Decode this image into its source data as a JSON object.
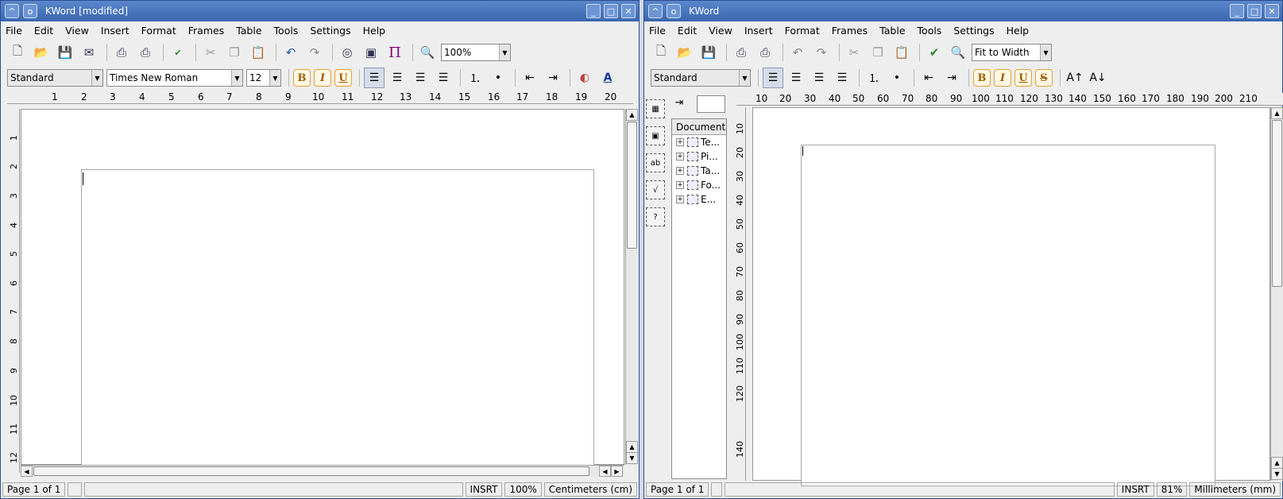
{
  "left": {
    "title": "KWord [modified]",
    "menu": [
      "File",
      "Edit",
      "View",
      "Insert",
      "Format",
      "Frames",
      "Table",
      "Tools",
      "Settings",
      "Help"
    ],
    "zoom": "100%",
    "style": "Standard",
    "font": "Times New Roman",
    "size": "12",
    "bold": "B",
    "italic": "I",
    "underline": "U",
    "ruler_h": [
      "1",
      "2",
      "3",
      "4",
      "5",
      "6",
      "7",
      "8",
      "9",
      "10",
      "11",
      "12",
      "13",
      "14",
      "15",
      "16",
      "17",
      "18",
      "19",
      "20"
    ],
    "ruler_v": [
      "1",
      "2",
      "3",
      "4",
      "5",
      "6",
      "7",
      "8",
      "9",
      "10",
      "11",
      "12"
    ],
    "status": {
      "page": "Page 1 of 1",
      "mode": "INSRT",
      "zoom": "100%",
      "unit": "Centimeters (cm)"
    }
  },
  "right": {
    "title": "KWord",
    "menu": [
      "File",
      "Edit",
      "View",
      "Insert",
      "Format",
      "Frames",
      "Table",
      "Tools",
      "Settings",
      "Help"
    ],
    "zoom": "Fit to Width",
    "style": "Standard",
    "bold": "B",
    "italic": "I",
    "underline": "U",
    "strike": "S",
    "ruler_h": [
      "10",
      "20",
      "30",
      "40",
      "50",
      "60",
      "70",
      "80",
      "90",
      "100",
      "110",
      "120",
      "130",
      "140",
      "150",
      "160",
      "170",
      "180",
      "190",
      "200",
      "210"
    ],
    "ruler_v": [
      "10",
      "20",
      "30",
      "40",
      "50",
      "60",
      "70",
      "80",
      "90",
      "100",
      "110",
      "120",
      "140"
    ],
    "doc_panel": {
      "header": "Document",
      "items": [
        "Te...",
        "Pi...",
        "Ta...",
        "Fo...",
        "E..."
      ]
    },
    "status": {
      "page": "Page 1 of 1",
      "mode": "INSRT",
      "zoom": "81%",
      "unit": "Millimeters (mm)"
    }
  }
}
